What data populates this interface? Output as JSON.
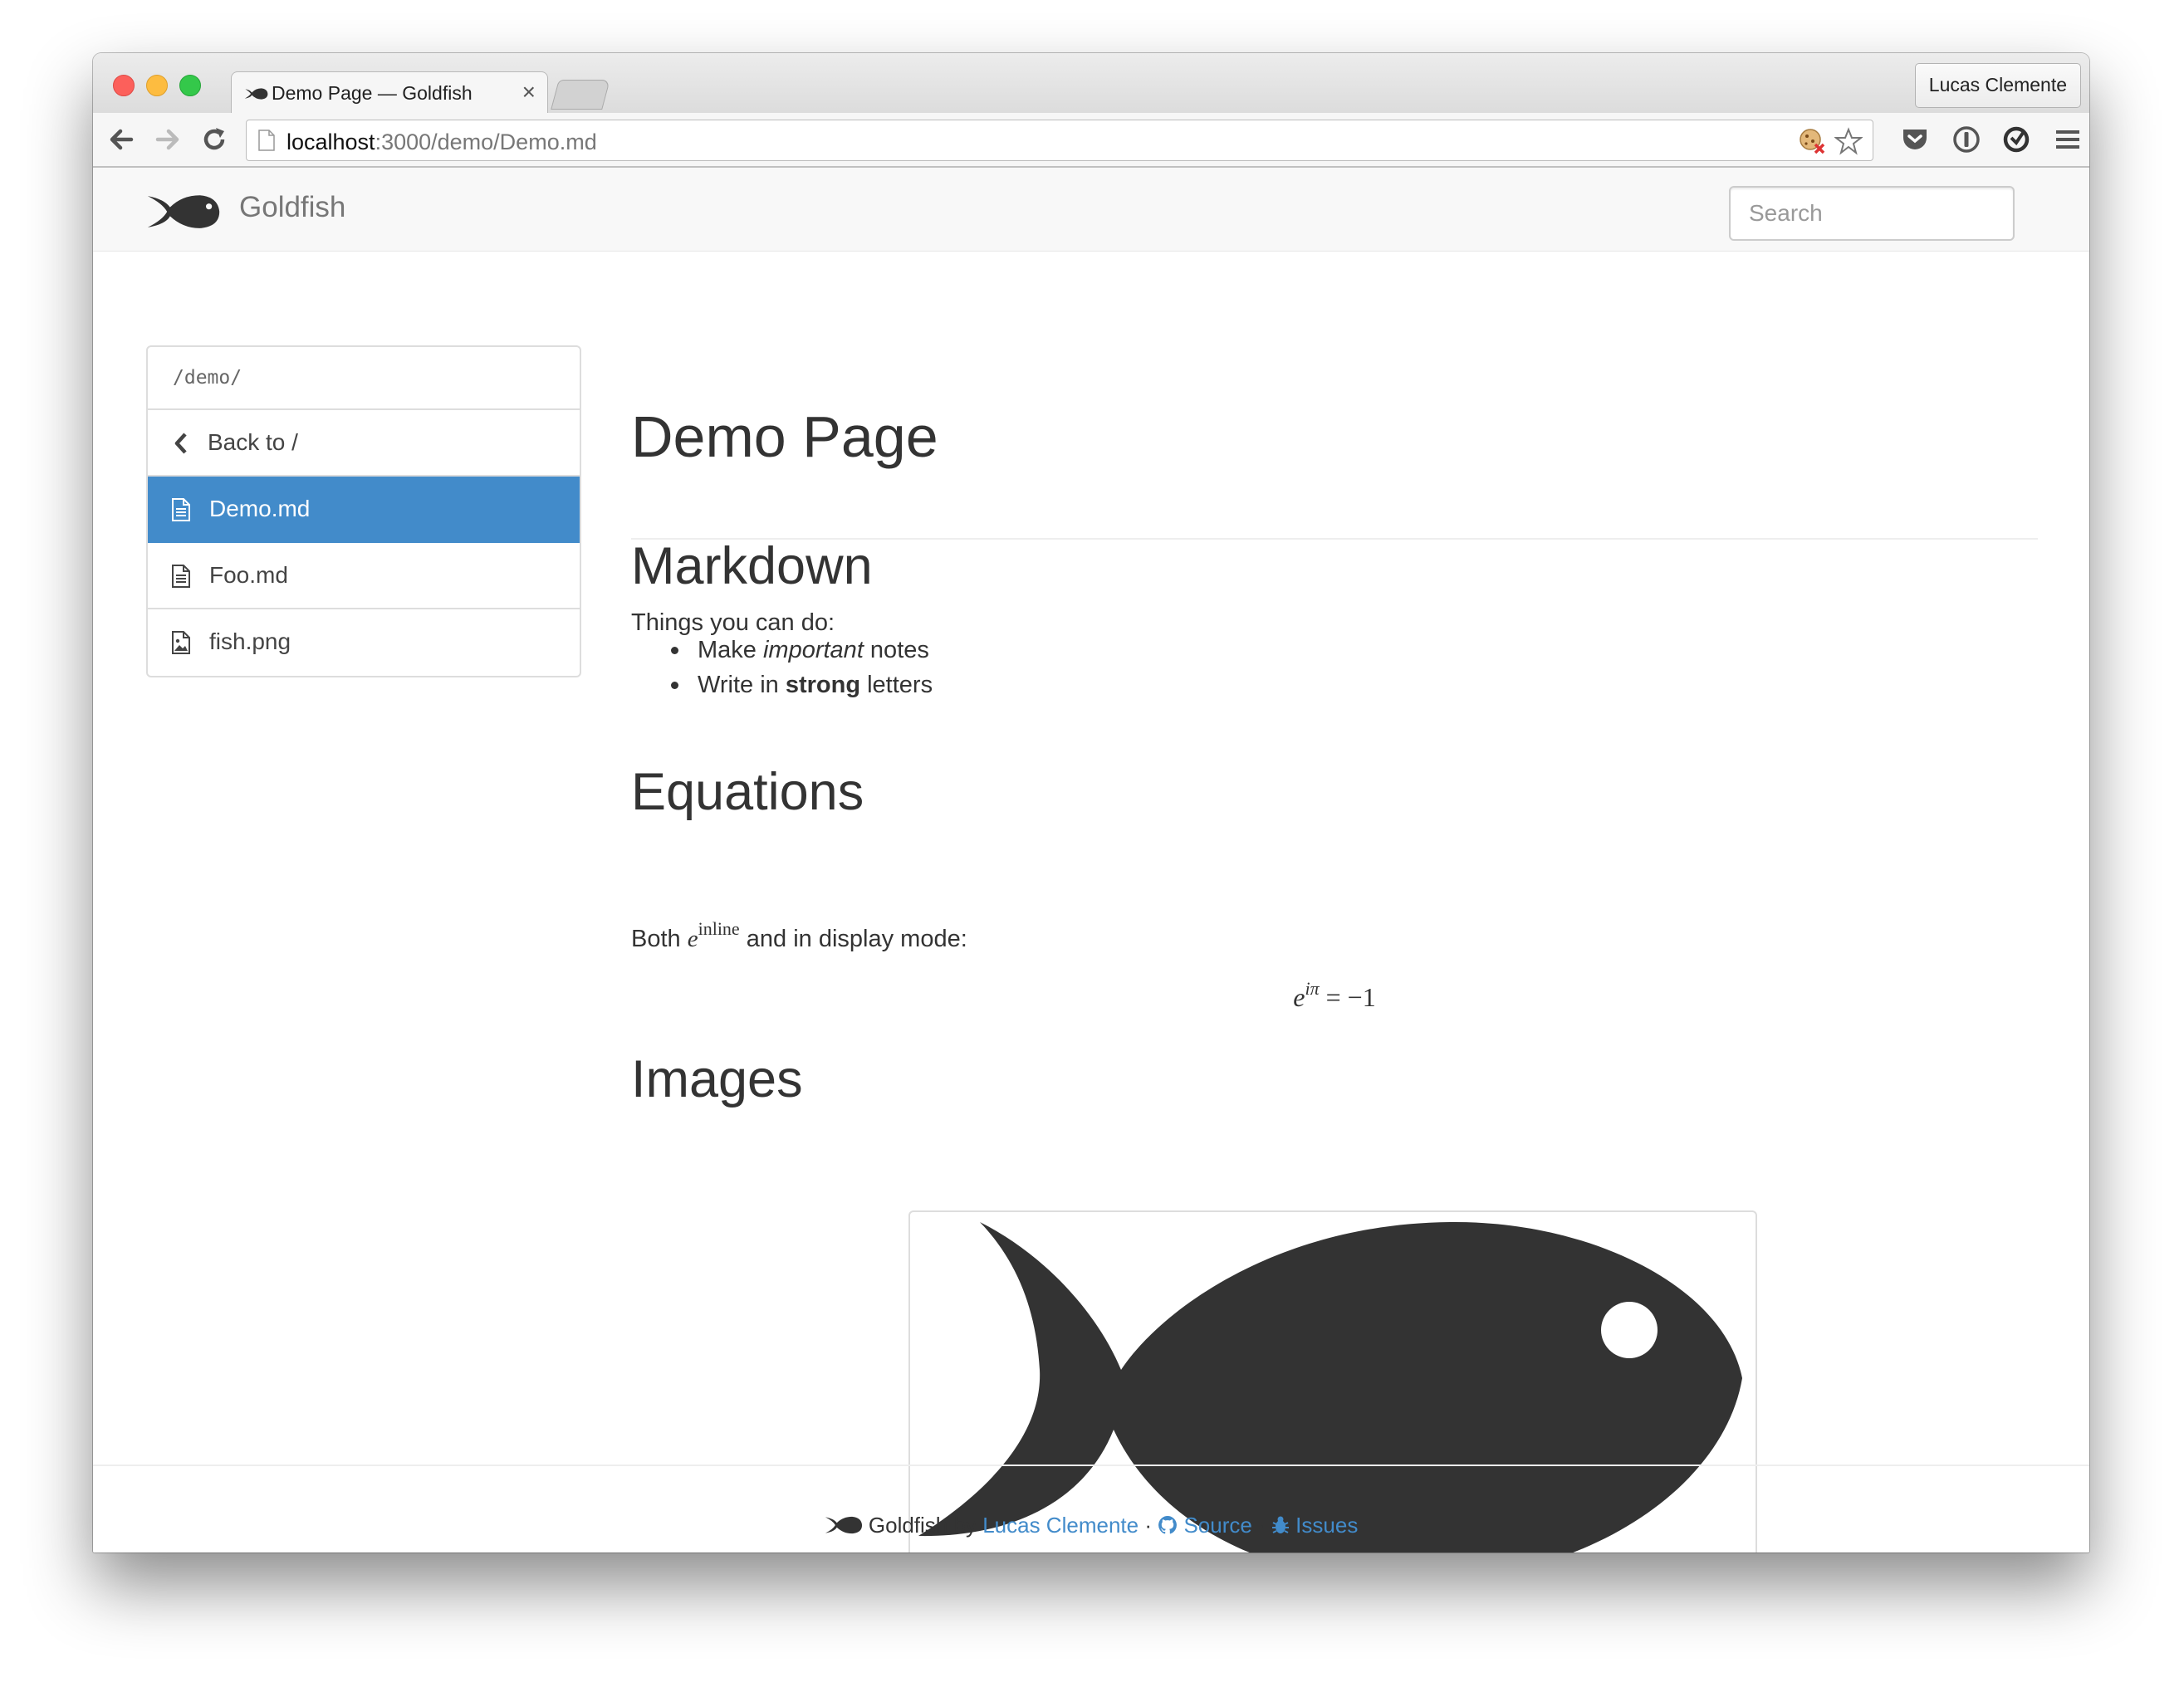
{
  "browser": {
    "tab_title": "Demo Page — Goldfish",
    "tab_close": "×",
    "profile_name": "Lucas Clemente",
    "url_host": "localhost",
    "url_path": ":3000/demo/Demo.md"
  },
  "navbar": {
    "brand": "Goldfish",
    "search_placeholder": "Search"
  },
  "sidebar": {
    "path": "/demo/",
    "back_label": "Back to /",
    "items": [
      {
        "label": "Demo.md",
        "icon": "file-text-icon",
        "active": true
      },
      {
        "label": "Foo.md",
        "icon": "file-text-icon",
        "active": false
      },
      {
        "label": "fish.png",
        "icon": "file-image-icon",
        "active": false
      }
    ]
  },
  "content": {
    "title": "Demo Page",
    "markdown_heading": "Markdown",
    "markdown_intro": "Things you can do:",
    "bullet1": {
      "pre": "Make ",
      "em": "important",
      "post": " notes"
    },
    "bullet2": {
      "pre": "Write in ",
      "strong": "strong",
      "post": " letters"
    },
    "equations_heading": "Equations",
    "equations_pre": "Both ",
    "inline_base": "e",
    "inline_sup": "inline",
    "equations_post": " and in display mode:",
    "display_base": "e",
    "display_sup": "iπ",
    "display_rest": " = −1",
    "images_heading": "Images"
  },
  "footer": {
    "brand": "Goldfish",
    "by": " by ",
    "author": "Lucas Clemente",
    "sep1": " · ",
    "source": "Source",
    "sep2": " · ",
    "issues": "Issues"
  },
  "colors": {
    "accent": "#428bca",
    "fish": "#333333"
  }
}
